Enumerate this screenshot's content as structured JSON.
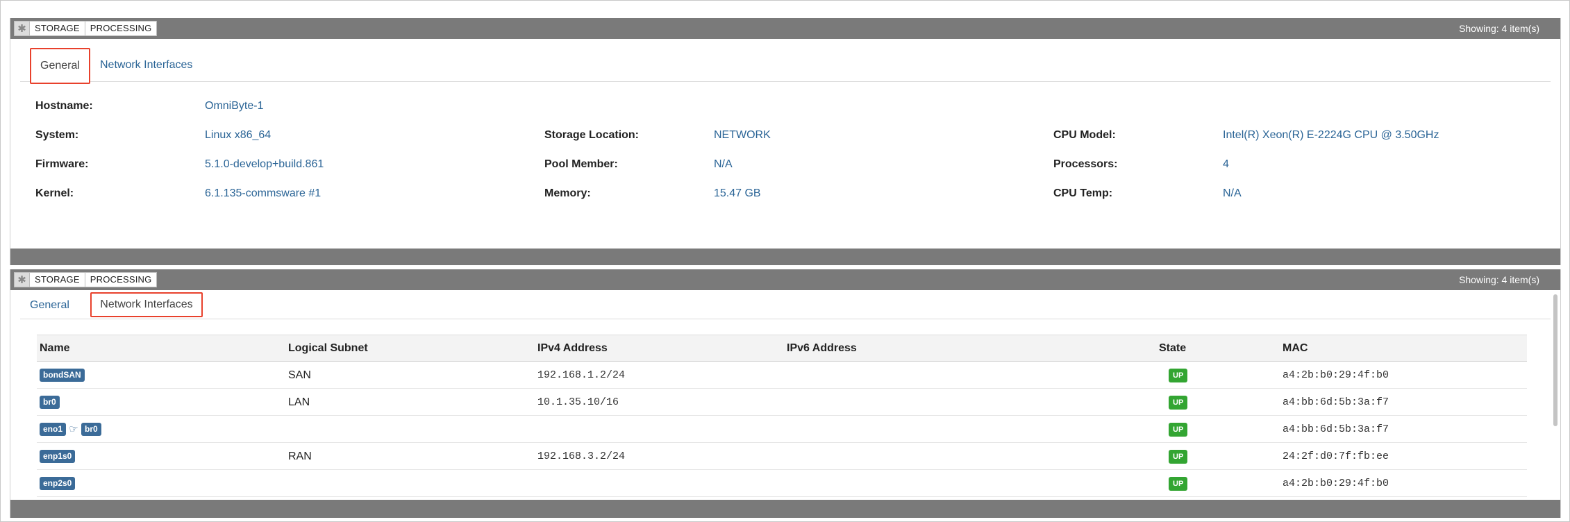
{
  "panel1": {
    "tags": [
      "STORAGE",
      "PROCESSING"
    ],
    "showing": "Showing: 4 item(s)",
    "tabs": [
      "General",
      "Network Interfaces"
    ],
    "active_tab": "General",
    "fields": {
      "hostname": {
        "label": "Hostname:",
        "value": "OmniByte-1"
      },
      "system": {
        "label": "System:",
        "value": "Linux x86_64"
      },
      "firmware": {
        "label": "Firmware:",
        "value": "5.1.0-develop+build.861"
      },
      "kernel": {
        "label": "Kernel:",
        "value": "6.1.135-commsware #1"
      },
      "storage_location": {
        "label": "Storage Location:",
        "value": "NETWORK"
      },
      "pool_member": {
        "label": "Pool Member:",
        "value": "N/A"
      },
      "memory": {
        "label": "Memory:",
        "value": "15.47 GB"
      },
      "cpu_model": {
        "label": "CPU Model:",
        "value": "Intel(R) Xeon(R) E-2224G CPU @ 3.50GHz"
      },
      "processors": {
        "label": "Processors:",
        "value": "4"
      },
      "cpu_temp": {
        "label": "CPU Temp:",
        "value": "N/A"
      }
    }
  },
  "panel2": {
    "tags": [
      "STORAGE",
      "PROCESSING"
    ],
    "showing": "Showing: 4 item(s)",
    "tabs": [
      "General",
      "Network Interfaces"
    ],
    "active_tab": "Network Interfaces",
    "table": {
      "columns": [
        "Name",
        "Logical Subnet",
        "IPv4 Address",
        "IPv6 Address",
        "State",
        "MAC"
      ],
      "rows": [
        {
          "name": "bondSAN",
          "link": "",
          "subnet": "SAN",
          "ipv4": "192.168.1.2/24",
          "ipv6": "",
          "state": "UP",
          "mac": "a4:2b:b0:29:4f:b0"
        },
        {
          "name": "br0",
          "link": "",
          "subnet": "LAN",
          "ipv4": "10.1.35.10/16",
          "ipv6": "",
          "state": "UP",
          "mac": "a4:bb:6d:5b:3a:f7"
        },
        {
          "name": "eno1",
          "link": "br0",
          "subnet": "",
          "ipv4": "",
          "ipv6": "",
          "state": "UP",
          "mac": "a4:bb:6d:5b:3a:f7"
        },
        {
          "name": "enp1s0",
          "link": "",
          "subnet": "RAN",
          "ipv4": "192.168.3.2/24",
          "ipv6": "",
          "state": "UP",
          "mac": "24:2f:d0:7f:fb:ee"
        },
        {
          "name": "enp2s0",
          "link": "",
          "subnet": "",
          "ipv4": "",
          "ipv6": "",
          "state": "UP",
          "mac": "a4:2b:b0:29:4f:b0"
        }
      ]
    }
  },
  "icons": {
    "gear": "gear-icon",
    "link": "pointing-hand-icon"
  },
  "colors": {
    "header_bar": "#7a7a7a",
    "link": "#2a6496",
    "iface_badge": "#3b6b98",
    "state_up": "#33a532",
    "active_tab_border": "#e8412c"
  }
}
